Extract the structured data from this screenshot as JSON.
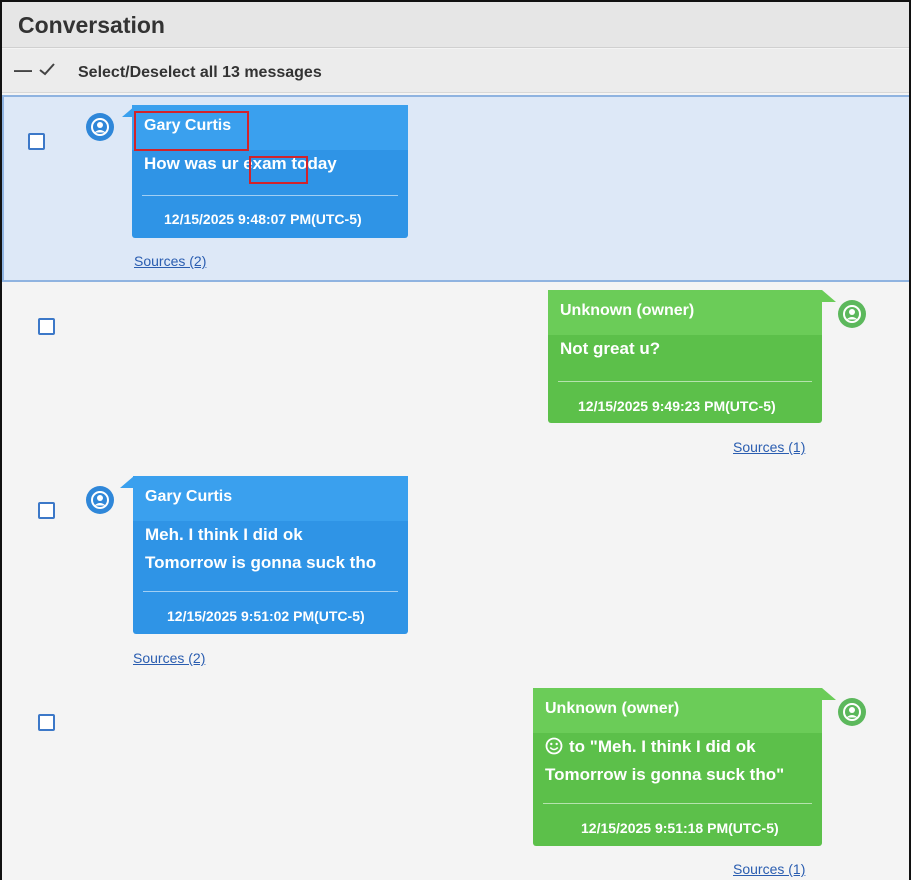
{
  "panel": {
    "title": "Conversation",
    "select_all_label": "Select/Deselect all 13 messages"
  },
  "colors": {
    "incoming": "#2f94e6",
    "outgoing": "#5cc04a",
    "selected_row": "#dde8f7",
    "highlight_box": "#d2232a",
    "link": "#2a5db0"
  },
  "messages": [
    {
      "sender": "Gary Curtis",
      "direction": "incoming",
      "selected": true,
      "text_before": "How was ur ",
      "text_highlight": "exam",
      "text_after": " today",
      "timestamp": "12/15/2025 9:48:07 PM(UTC-5)",
      "sources": "Sources (2)",
      "avatar_icon": "person-icon"
    },
    {
      "sender": "Unknown (owner)",
      "direction": "outgoing",
      "selected": false,
      "lines": [
        "Not great u?"
      ],
      "timestamp": "12/15/2025 9:49:23 PM(UTC-5)",
      "sources": "Sources (1)",
      "avatar_icon": "person-icon"
    },
    {
      "sender": "Gary Curtis",
      "direction": "incoming",
      "selected": false,
      "lines": [
        "Meh. I think I did ok",
        "Tomorrow is gonna suck tho"
      ],
      "timestamp": "12/15/2025 9:51:02 PM(UTC-5)",
      "sources": "Sources (2)",
      "avatar_icon": "person-icon"
    },
    {
      "sender": "Unknown (owner)",
      "direction": "outgoing",
      "selected": false,
      "reaction_icon": "smiley-reaction-icon",
      "lines": [
        "to \"Meh. I think I did ok",
        "Tomorrow is gonna suck tho\""
      ],
      "timestamp": "12/15/2025 9:51:18 PM(UTC-5)",
      "sources": "Sources (1)",
      "avatar_icon": "person-icon"
    }
  ]
}
